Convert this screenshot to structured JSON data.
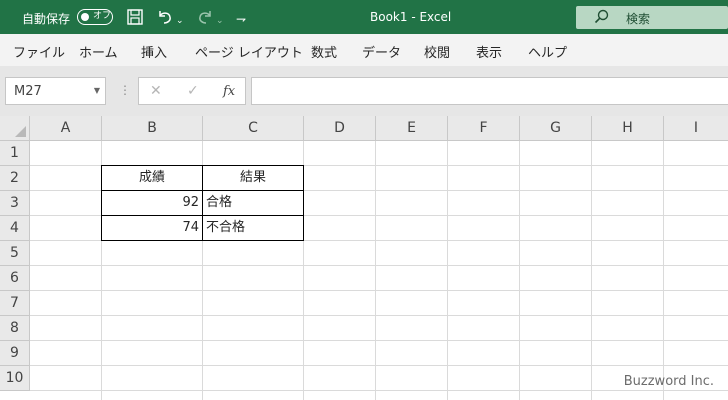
{
  "titlebar": {
    "autosave_label": "自動保存",
    "autosave_state": "オフ",
    "doc_title": "Book1  -  Excel",
    "search_placeholder": "検索",
    "icons": [
      "save-icon",
      "undo-icon",
      "redo-icon",
      "customize-qat-icon"
    ],
    "accent_color": "#217346"
  },
  "tabs": [
    "ファイル",
    "ホーム",
    "挿入",
    "ページ レイアウト",
    "数式",
    "データ",
    "校閲",
    "表示",
    "ヘルプ"
  ],
  "formula_bar": {
    "name_box": "M27",
    "cancel_glyph": "✕",
    "enter_glyph": "✓",
    "fx_label": "fx",
    "formula": ""
  },
  "sheet": {
    "columns": [
      "A",
      "B",
      "C",
      "D",
      "E",
      "F",
      "G",
      "H",
      "I"
    ],
    "rows": [
      "1",
      "2",
      "3",
      "4",
      "5",
      "6",
      "7",
      "8",
      "9",
      "10"
    ],
    "table": {
      "headers": [
        "成績",
        "結果"
      ],
      "rows": [
        [
          "92",
          "合格"
        ],
        [
          "74",
          "不合格"
        ]
      ]
    }
  },
  "watermark": "Buzzword Inc."
}
